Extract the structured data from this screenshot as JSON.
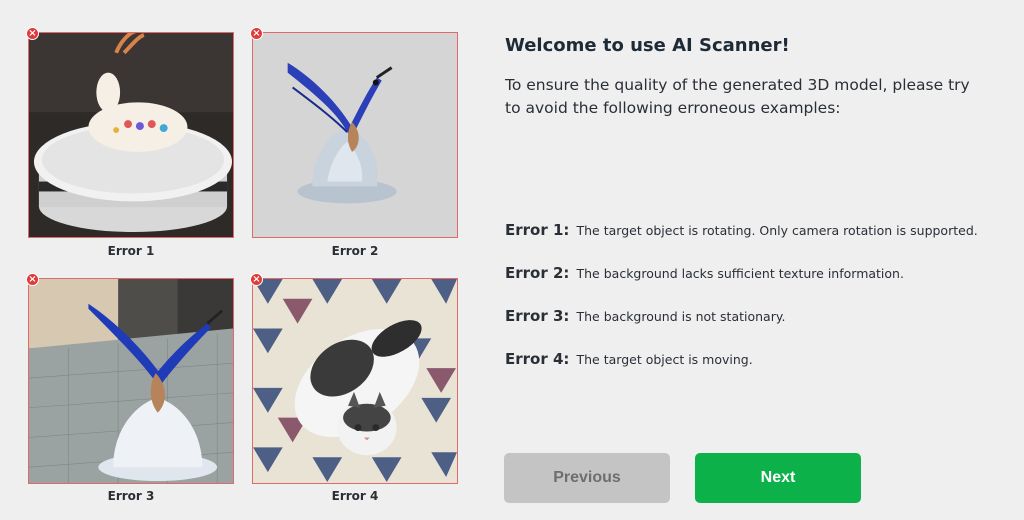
{
  "welcome": {
    "title": "Welcome to use AI Scanner!",
    "intro": "To ensure the quality of the generated 3D model, please try to avoid the following erroneous examples:"
  },
  "examples": [
    {
      "caption": "Error 1"
    },
    {
      "caption": "Error 2"
    },
    {
      "caption": "Error 3"
    },
    {
      "caption": "Error 4"
    }
  ],
  "errors": [
    {
      "label": "Error 1:",
      "text": "The target object is rotating. Only camera rotation is supported."
    },
    {
      "label": "Error 2:",
      "text": "The background lacks sufficient texture information."
    },
    {
      "label": "Error 3:",
      "text": "The background is not stationary."
    },
    {
      "label": "Error 4:",
      "text": "The target object is moving."
    }
  ],
  "buttons": {
    "previous": "Previous",
    "next": "Next"
  },
  "colors": {
    "next_button": "#0db14a",
    "previous_button": "#c4c4c4",
    "error_badge": "#e03a3a",
    "thumb_border": "#e06a6a"
  },
  "icons": {
    "error_badge": "error-x-icon"
  }
}
